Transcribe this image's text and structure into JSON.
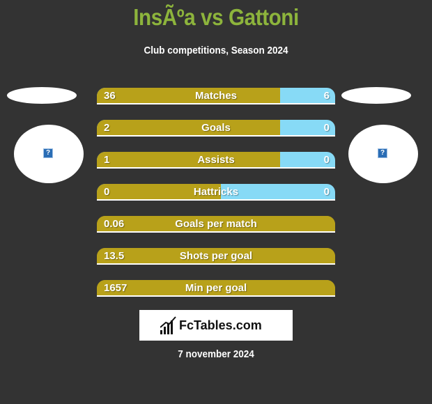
{
  "header": {
    "title": "InsÃºa vs Gattoni",
    "subtitle": "Club competitions, Season 2024"
  },
  "players": {
    "left": {
      "image_icon": "broken-image-icon",
      "icon_glyph": "?"
    },
    "right": {
      "image_icon": "broken-image-icon",
      "icon_glyph": "?"
    }
  },
  "colors": {
    "background": "#333333",
    "title": "#8db43c",
    "left_bar": "#b8a11a",
    "right_bar": "#87daf6"
  },
  "stats": [
    {
      "label": "Matches",
      "left": "36",
      "right": "6",
      "left_share": 0.77
    },
    {
      "label": "Goals",
      "left": "2",
      "right": "0",
      "left_share": 0.77
    },
    {
      "label": "Assists",
      "left": "1",
      "right": "0",
      "left_share": 0.77
    },
    {
      "label": "Hattricks",
      "left": "0",
      "right": "0",
      "left_share": 0.52
    },
    {
      "label": "Goals per match",
      "left": "0.06",
      "right": null,
      "left_share": 1
    },
    {
      "label": "Shots per goal",
      "left": "13.5",
      "right": null,
      "left_share": 1
    },
    {
      "label": "Min per goal",
      "left": "1657",
      "right": null,
      "left_share": 1
    }
  ],
  "logo": {
    "text": "FcTables.com",
    "icon": "bar-chart-icon"
  },
  "footer": {
    "date": "7 november 2024"
  }
}
